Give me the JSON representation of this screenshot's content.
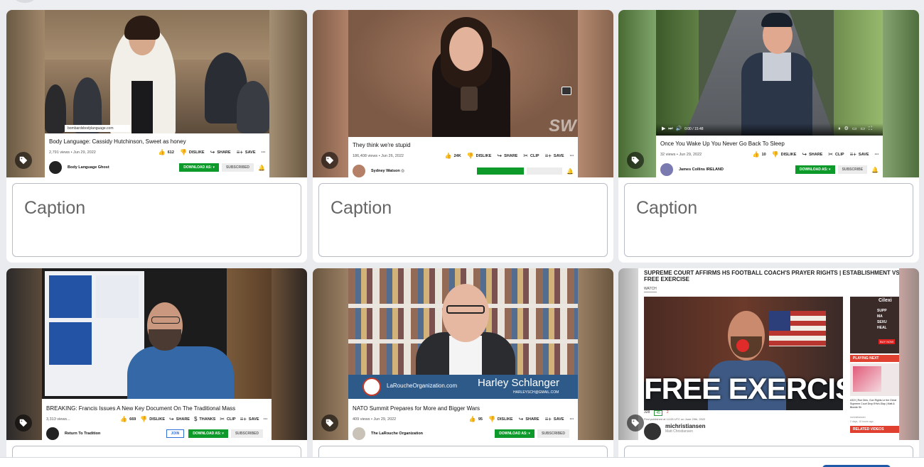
{
  "caption_placeholder": "Caption",
  "cards": [
    {
      "title": "Body Language: Cassidy Hutchinson, Sweet as honey",
      "meta": "2,791 views • Jun 29, 2022",
      "likes": "612",
      "actions": [
        "DISLIKE",
        "SHARE",
        "SAVE"
      ],
      "channel": "Body Language Ghost",
      "download": "DOWNLOAD AS: ▾",
      "subscribed": "SUBSCRIBED",
      "watermark": "bombardsbodylanguage.com"
    },
    {
      "title": "They think we're stupid",
      "meta": "186,408 views • Jun 26, 2022",
      "likes": "24K",
      "actions": [
        "DISLIKE",
        "SHARE",
        "CLIP",
        "SAVE"
      ],
      "channel": "Sydney Watson ◎",
      "logo": "SW"
    },
    {
      "title": "Once You Wake Up You Never Go Back To Sleep",
      "meta": "32 views • Jun 29, 2022",
      "likes": "10",
      "actions": [
        "DISLIKE",
        "SHARE",
        "CLIP",
        "SAVE"
      ],
      "channel": "James Collins IRELAND",
      "download": "DOWNLOAD AS: ▾",
      "subscribed": "SUBSCRIBE",
      "time": "0:00 / 15:48"
    },
    {
      "title": "BREAKING: Francis Issues A New Key Document On The Traditional Mass",
      "meta": "3,313 views...",
      "likes": "669",
      "actions": [
        "DISLIKE",
        "SHARE",
        "THANKS",
        "CLIP",
        "SAVE"
      ],
      "channel": "Return To Tradition",
      "join": "JOIN",
      "download": "DOWNLOAD AS: ▾",
      "subscribed": "SUBSCRIBED"
    },
    {
      "title": "NATO Summit Prepares for More and Bigger Wars",
      "meta": "409 views • Jun 29, 2022",
      "likes": "95",
      "actions": [
        "DISLIKE",
        "SHARE",
        "SAVE"
      ],
      "channel": "The LaRouche Organization",
      "download": "DOWNLOAD AS: ▾",
      "subscribed": "SUBSCRIBED",
      "lower_third_site": "LaRoucheOrganization.com",
      "lower_third_name": "Harley Schlanger",
      "lower_third_email": "HARLEYSCH@GMAIL.COM"
    },
    {
      "headline": "SUPREME COURT AFFIRMS HS FOOTBALL COACH'S PRAYER RIGHTS | ESTABLISHMENT VS FREE EXERCISE",
      "watch": "WATCH",
      "overlay_text": "FREE EXERCISE",
      "views": "328",
      "likes": "45",
      "dislikes": "2",
      "published": "First published at 14:05 UTC on June 29th, 2022",
      "channel": "michristiansen",
      "channel_sub": "Matt Christiansen",
      "side_playing_next": "PLAYING NEXT",
      "side_related": "RELATED VIDEOS",
      "side_item_title": "#319 | Roe Dies, Gun Rights Le the Great Supreme Court Drop B*tch-Slap | Matt & Blonde Sh",
      "side_item_channel": "mchristiansen",
      "side_item_time": "2 days, 10 hours ago",
      "ad_brand": "Cilexi",
      "ad_lines": [
        "SUPP",
        "MA",
        "SEXU",
        "HEAL"
      ],
      "ad_buy": "BUY NOW"
    }
  ]
}
